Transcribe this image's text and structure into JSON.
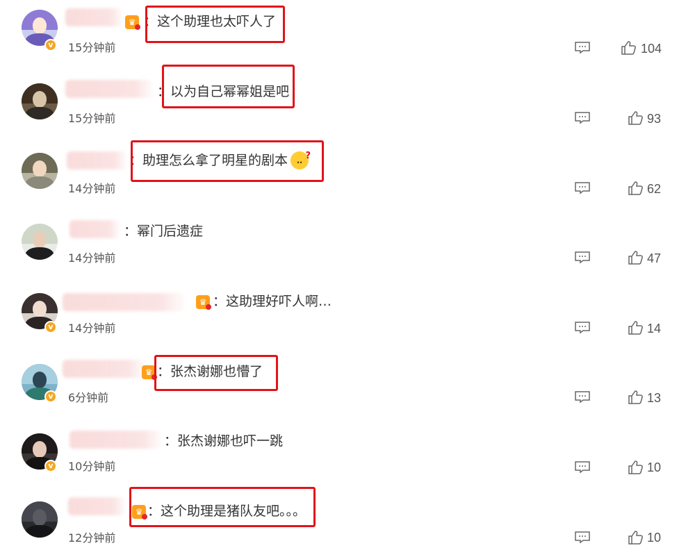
{
  "ui": {
    "accent": "#e0141a",
    "crown_color": "#ff9f1a",
    "verified_color": "#f5a623"
  },
  "comments": [
    {
      "text": "：这个助理也太吓人了",
      "time": "15分钟前",
      "likes": "104",
      "highlighted": true,
      "verified": true,
      "crown": true
    },
    {
      "text": "：以为自己幂幂姐是吧",
      "time": "15分钟前",
      "likes": "93",
      "highlighted": true,
      "verified": false,
      "crown": false
    },
    {
      "text": "：助理怎么拿了明星的剧本",
      "time": "14分钟前",
      "likes": "62",
      "highlighted": true,
      "verified": false,
      "crown": false,
      "emoji": "thinking-face"
    },
    {
      "text": "：幂门后遗症",
      "time": "14分钟前",
      "likes": "47",
      "highlighted": false,
      "verified": false,
      "crown": false
    },
    {
      "text": "：这助理好吓人啊…",
      "time": "14分钟前",
      "likes": "14",
      "highlighted": false,
      "verified": true,
      "crown": true
    },
    {
      "text": "：张杰谢娜也懵了",
      "time": "6分钟前",
      "likes": "13",
      "highlighted": true,
      "verified": true,
      "crown": true
    },
    {
      "text": "：张杰谢娜也吓一跳",
      "time": "10分钟前",
      "likes": "10",
      "highlighted": false,
      "verified": true,
      "crown": false
    },
    {
      "text": "：这个助理是猪队友吧。。。",
      "time": "12分钟前",
      "likes": "10",
      "highlighted": true,
      "verified": false,
      "crown": true
    }
  ]
}
